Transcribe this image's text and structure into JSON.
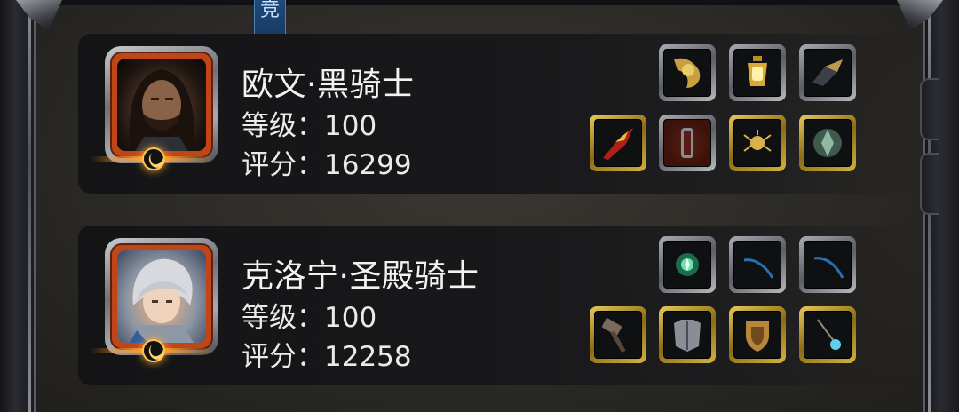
{
  "tab": {
    "label": "竞"
  },
  "heroes": [
    {
      "name": "欧文·黑骑士",
      "level_text": "等级：100",
      "score_text": "评分：16299",
      "portrait_icon": "dark-haired-knight-portrait",
      "equipment_top": [
        "golden-shoulder-armor-icon",
        "golden-lantern-icon",
        "dark-gauntlet-icon"
      ],
      "equipment_bottom": [
        "red-claw-weapon-icon",
        "red-cape-armor-icon",
        "spider-amulet-icon",
        "green-crest-shield-icon"
      ]
    },
    {
      "name": "克洛宁·圣殿骑士",
      "level_text": "等级：100",
      "score_text": "评分：12258",
      "portrait_icon": "silver-haired-knight-portrait",
      "equipment_top": [
        "green-orb-gem-icon",
        "blue-bow-icon",
        "blue-bow-icon"
      ],
      "equipment_bottom": [
        "war-hammer-icon",
        "steel-chestplate-icon",
        "golden-shield-icon",
        "blue-pendant-icon"
      ]
    }
  ],
  "colors": {
    "portrait_border": "#c0461a",
    "slot_silver": "#a9acb2",
    "slot_gold": "#e7c95a",
    "moon_glow": "#ffae33",
    "tab_blue": "#1f4a7c"
  }
}
